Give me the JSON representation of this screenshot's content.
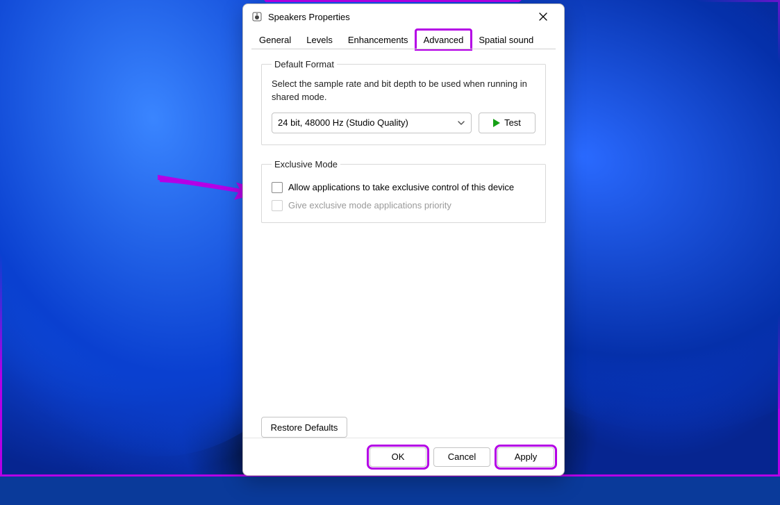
{
  "window": {
    "title": "Speakers Properties"
  },
  "tabs": {
    "items": [
      {
        "label": "General"
      },
      {
        "label": "Levels"
      },
      {
        "label": "Enhancements"
      },
      {
        "label": "Advanced"
      },
      {
        "label": "Spatial sound"
      }
    ],
    "active_index": 3
  },
  "default_format": {
    "legend": "Default Format",
    "help": "Select the sample rate and bit depth to be used when running in shared mode.",
    "selected": "24 bit, 48000 Hz (Studio Quality)",
    "test_label": "Test"
  },
  "exclusive_mode": {
    "legend": "Exclusive Mode",
    "allow_label": "Allow applications to take exclusive control of this device",
    "allow_checked": false,
    "priority_label": "Give exclusive mode applications priority",
    "priority_checked": false,
    "priority_enabled": false
  },
  "restore_defaults_label": "Restore Defaults",
  "buttons": {
    "ok": "OK",
    "cancel": "Cancel",
    "apply": "Apply"
  },
  "annotation": {
    "color": "#b400e6"
  }
}
